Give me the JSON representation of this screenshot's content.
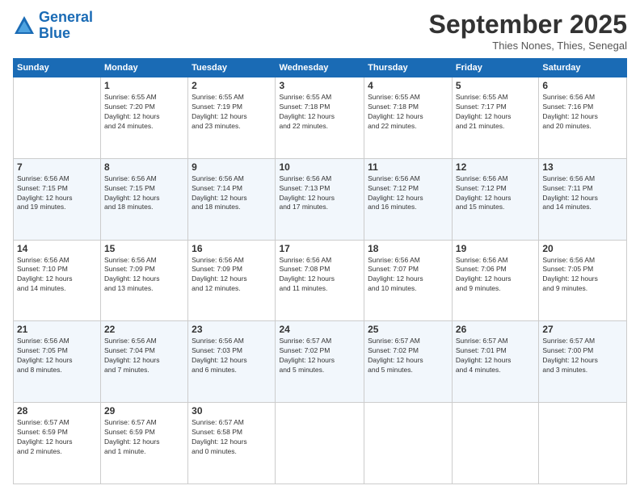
{
  "header": {
    "logo_line1": "General",
    "logo_line2": "Blue",
    "month": "September 2025",
    "location": "Thies Nones, Thies, Senegal"
  },
  "weekdays": [
    "Sunday",
    "Monday",
    "Tuesday",
    "Wednesday",
    "Thursday",
    "Friday",
    "Saturday"
  ],
  "weeks": [
    [
      {
        "day": "",
        "info": ""
      },
      {
        "day": "1",
        "info": "Sunrise: 6:55 AM\nSunset: 7:20 PM\nDaylight: 12 hours\nand 24 minutes."
      },
      {
        "day": "2",
        "info": "Sunrise: 6:55 AM\nSunset: 7:19 PM\nDaylight: 12 hours\nand 23 minutes."
      },
      {
        "day": "3",
        "info": "Sunrise: 6:55 AM\nSunset: 7:18 PM\nDaylight: 12 hours\nand 22 minutes."
      },
      {
        "day": "4",
        "info": "Sunrise: 6:55 AM\nSunset: 7:18 PM\nDaylight: 12 hours\nand 22 minutes."
      },
      {
        "day": "5",
        "info": "Sunrise: 6:55 AM\nSunset: 7:17 PM\nDaylight: 12 hours\nand 21 minutes."
      },
      {
        "day": "6",
        "info": "Sunrise: 6:56 AM\nSunset: 7:16 PM\nDaylight: 12 hours\nand 20 minutes."
      }
    ],
    [
      {
        "day": "7",
        "info": "Sunrise: 6:56 AM\nSunset: 7:15 PM\nDaylight: 12 hours\nand 19 minutes."
      },
      {
        "day": "8",
        "info": "Sunrise: 6:56 AM\nSunset: 7:15 PM\nDaylight: 12 hours\nand 18 minutes."
      },
      {
        "day": "9",
        "info": "Sunrise: 6:56 AM\nSunset: 7:14 PM\nDaylight: 12 hours\nand 18 minutes."
      },
      {
        "day": "10",
        "info": "Sunrise: 6:56 AM\nSunset: 7:13 PM\nDaylight: 12 hours\nand 17 minutes."
      },
      {
        "day": "11",
        "info": "Sunrise: 6:56 AM\nSunset: 7:12 PM\nDaylight: 12 hours\nand 16 minutes."
      },
      {
        "day": "12",
        "info": "Sunrise: 6:56 AM\nSunset: 7:12 PM\nDaylight: 12 hours\nand 15 minutes."
      },
      {
        "day": "13",
        "info": "Sunrise: 6:56 AM\nSunset: 7:11 PM\nDaylight: 12 hours\nand 14 minutes."
      }
    ],
    [
      {
        "day": "14",
        "info": "Sunrise: 6:56 AM\nSunset: 7:10 PM\nDaylight: 12 hours\nand 14 minutes."
      },
      {
        "day": "15",
        "info": "Sunrise: 6:56 AM\nSunset: 7:09 PM\nDaylight: 12 hours\nand 13 minutes."
      },
      {
        "day": "16",
        "info": "Sunrise: 6:56 AM\nSunset: 7:09 PM\nDaylight: 12 hours\nand 12 minutes."
      },
      {
        "day": "17",
        "info": "Sunrise: 6:56 AM\nSunset: 7:08 PM\nDaylight: 12 hours\nand 11 minutes."
      },
      {
        "day": "18",
        "info": "Sunrise: 6:56 AM\nSunset: 7:07 PM\nDaylight: 12 hours\nand 10 minutes."
      },
      {
        "day": "19",
        "info": "Sunrise: 6:56 AM\nSunset: 7:06 PM\nDaylight: 12 hours\nand 9 minutes."
      },
      {
        "day": "20",
        "info": "Sunrise: 6:56 AM\nSunset: 7:05 PM\nDaylight: 12 hours\nand 9 minutes."
      }
    ],
    [
      {
        "day": "21",
        "info": "Sunrise: 6:56 AM\nSunset: 7:05 PM\nDaylight: 12 hours\nand 8 minutes."
      },
      {
        "day": "22",
        "info": "Sunrise: 6:56 AM\nSunset: 7:04 PM\nDaylight: 12 hours\nand 7 minutes."
      },
      {
        "day": "23",
        "info": "Sunrise: 6:56 AM\nSunset: 7:03 PM\nDaylight: 12 hours\nand 6 minutes."
      },
      {
        "day": "24",
        "info": "Sunrise: 6:57 AM\nSunset: 7:02 PM\nDaylight: 12 hours\nand 5 minutes."
      },
      {
        "day": "25",
        "info": "Sunrise: 6:57 AM\nSunset: 7:02 PM\nDaylight: 12 hours\nand 5 minutes."
      },
      {
        "day": "26",
        "info": "Sunrise: 6:57 AM\nSunset: 7:01 PM\nDaylight: 12 hours\nand 4 minutes."
      },
      {
        "day": "27",
        "info": "Sunrise: 6:57 AM\nSunset: 7:00 PM\nDaylight: 12 hours\nand 3 minutes."
      }
    ],
    [
      {
        "day": "28",
        "info": "Sunrise: 6:57 AM\nSunset: 6:59 PM\nDaylight: 12 hours\nand 2 minutes."
      },
      {
        "day": "29",
        "info": "Sunrise: 6:57 AM\nSunset: 6:59 PM\nDaylight: 12 hours\nand 1 minute."
      },
      {
        "day": "30",
        "info": "Sunrise: 6:57 AM\nSunset: 6:58 PM\nDaylight: 12 hours\nand 0 minutes."
      },
      {
        "day": "",
        "info": ""
      },
      {
        "day": "",
        "info": ""
      },
      {
        "day": "",
        "info": ""
      },
      {
        "day": "",
        "info": ""
      }
    ]
  ]
}
